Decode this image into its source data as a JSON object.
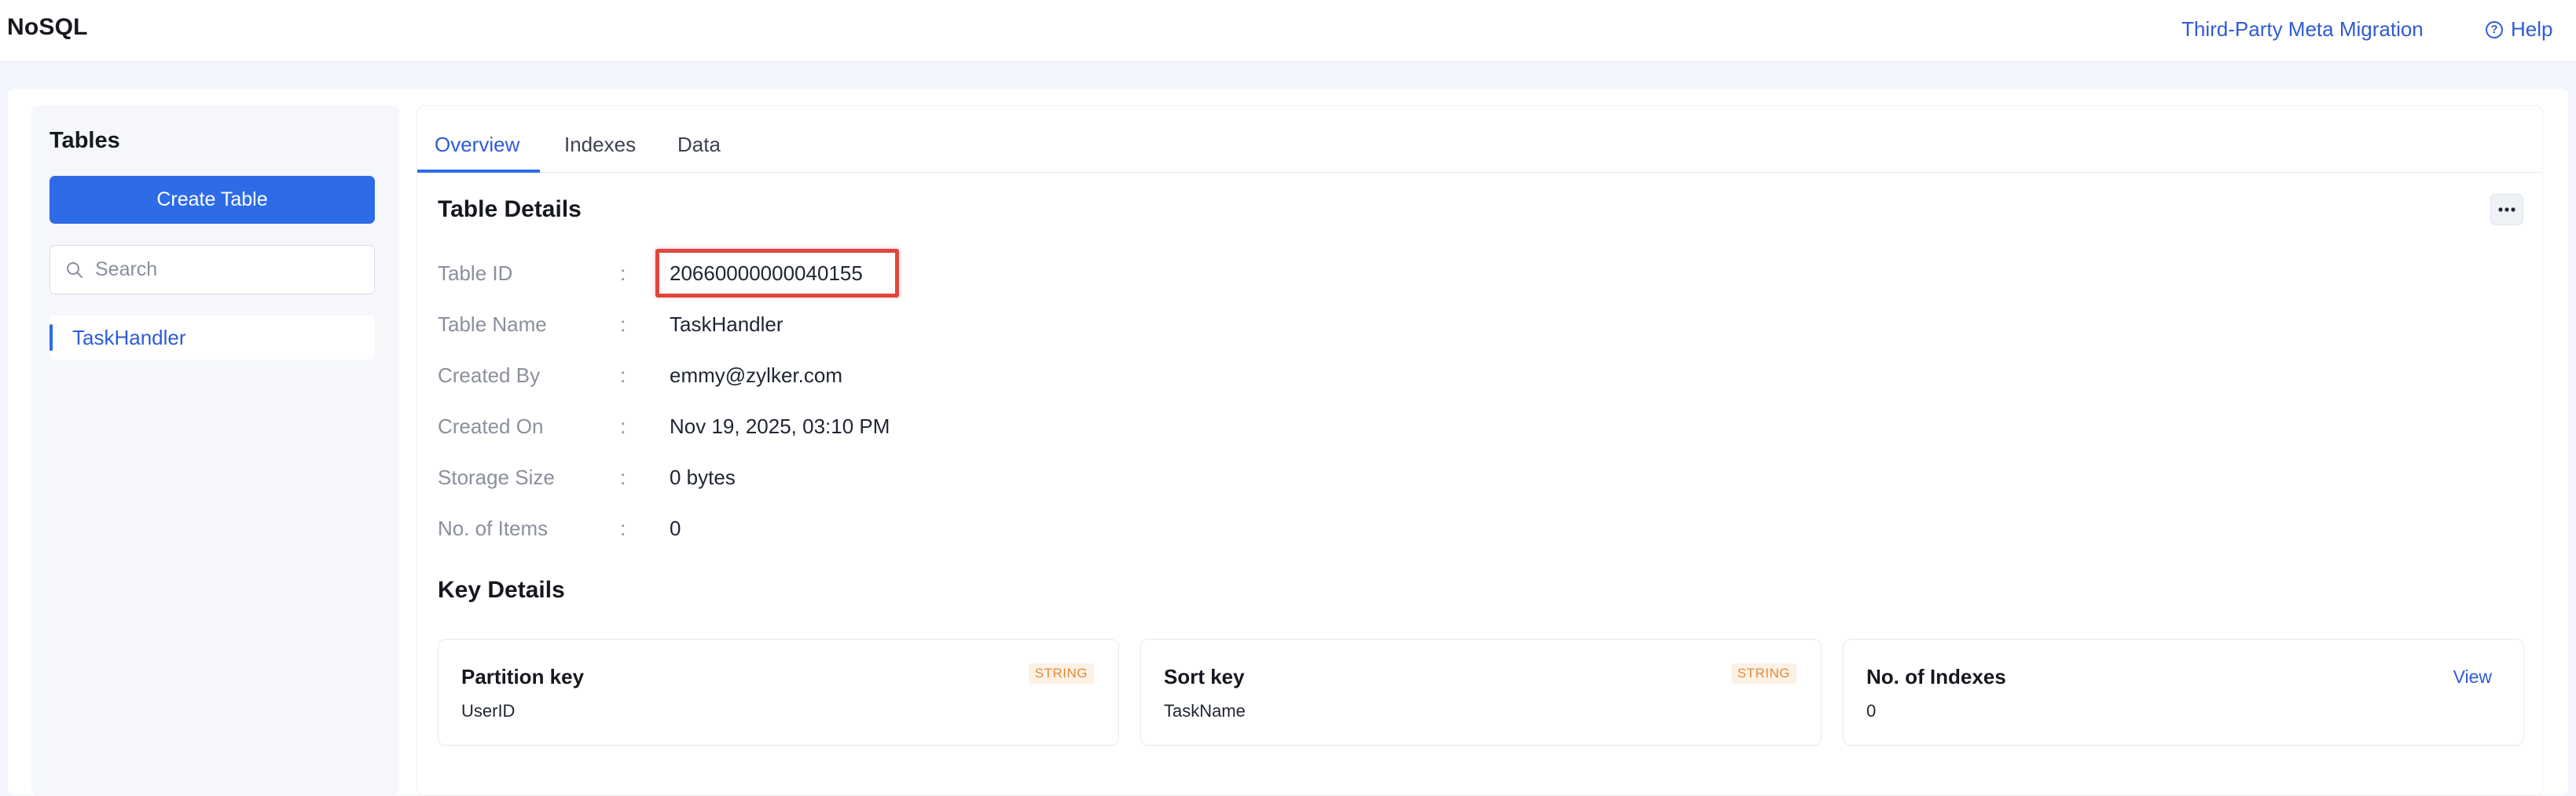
{
  "header": {
    "app_title": "NoSQL",
    "migration_link": "Third-Party Meta Migration",
    "help_link": "Help"
  },
  "sidebar": {
    "heading": "Tables",
    "create_button": "Create Table",
    "search_placeholder": "Search",
    "tables": [
      {
        "label": "TaskHandler"
      }
    ]
  },
  "tabs": [
    {
      "label": "Overview"
    },
    {
      "label": "Indexes"
    },
    {
      "label": "Data"
    }
  ],
  "table_details": {
    "title": "Table Details",
    "separator": ":",
    "rows": [
      {
        "label": "Table ID",
        "value": "20660000000040155"
      },
      {
        "label": "Table Name",
        "value": "TaskHandler"
      },
      {
        "label": "Created By",
        "value": "emmy@zylker.com"
      },
      {
        "label": "Created On",
        "value": "Nov 19, 2025, 03:10 PM"
      },
      {
        "label": "Storage Size",
        "value": "0 bytes"
      },
      {
        "label": "No. of Items",
        "value": "0"
      }
    ]
  },
  "key_details": {
    "title": "Key Details",
    "cards": [
      {
        "title": "Partition key",
        "value": "UserID",
        "badge": "STRING"
      },
      {
        "title": "Sort key",
        "value": "TaskName",
        "badge": "STRING"
      },
      {
        "title": "No. of Indexes",
        "value": "0",
        "action": "View"
      }
    ]
  },
  "colors": {
    "accent": "#2e6be6",
    "link": "#2f5bd3",
    "highlight": "#e0463c",
    "badge_text": "#e08a3c"
  },
  "icons": {
    "search": "search-icon",
    "help": "help-circle-icon",
    "more": "more-horizontal-icon"
  }
}
